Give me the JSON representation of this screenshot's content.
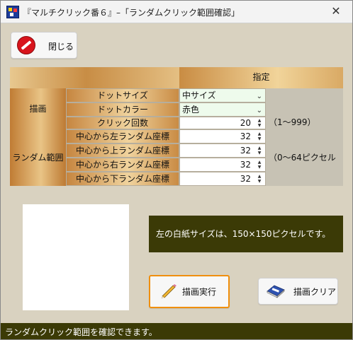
{
  "window": {
    "title": "『マルチクリック番６』–「ランダムクリック範囲確認」",
    "close_glyph": "✕"
  },
  "toolbar": {
    "close_label": "閉じる"
  },
  "table": {
    "header_spec": "指定",
    "groups": {
      "draw": "描画",
      "range": "ランダム範囲"
    },
    "rows": [
      {
        "label": "ドットサイズ",
        "value": "中サイズ",
        "type": "select",
        "note": ""
      },
      {
        "label": "ドットカラー",
        "value": "赤色",
        "type": "select",
        "note": ""
      },
      {
        "label": "クリック回数",
        "value": "20",
        "type": "number",
        "note": "（1～999）"
      },
      {
        "label": "中心から左ランダム座標",
        "value": "32",
        "type": "number",
        "note": ""
      },
      {
        "label": "中心から上ランダム座標",
        "value": "32",
        "type": "number",
        "note": ""
      },
      {
        "label": "中心から右ランダム座標",
        "value": "32",
        "type": "number",
        "note": ""
      },
      {
        "label": "中心から下ランダム座標",
        "value": "32",
        "type": "number",
        "note": ""
      }
    ],
    "range_note": "（0～64ピクセル"
  },
  "info_text": "左の白紙サイズは、150×150ピクセルです。",
  "actions": {
    "draw_label": "描画実行",
    "clear_label": "描画クリア"
  },
  "status": "ランダムクリック範囲を確認できます。",
  "icons": {
    "app": "app-icon",
    "close": "no-entry-icon",
    "spin_up": "▲",
    "spin_down": "▼",
    "dropdown": "⌄",
    "draw": "pencil-icon",
    "clear": "eraser-icon"
  },
  "colors": {
    "status_bg": "#3b3a06",
    "window_bg": "#d9d2c0",
    "accent_border": "#f08f0e",
    "close_icon": "#d8141c"
  }
}
